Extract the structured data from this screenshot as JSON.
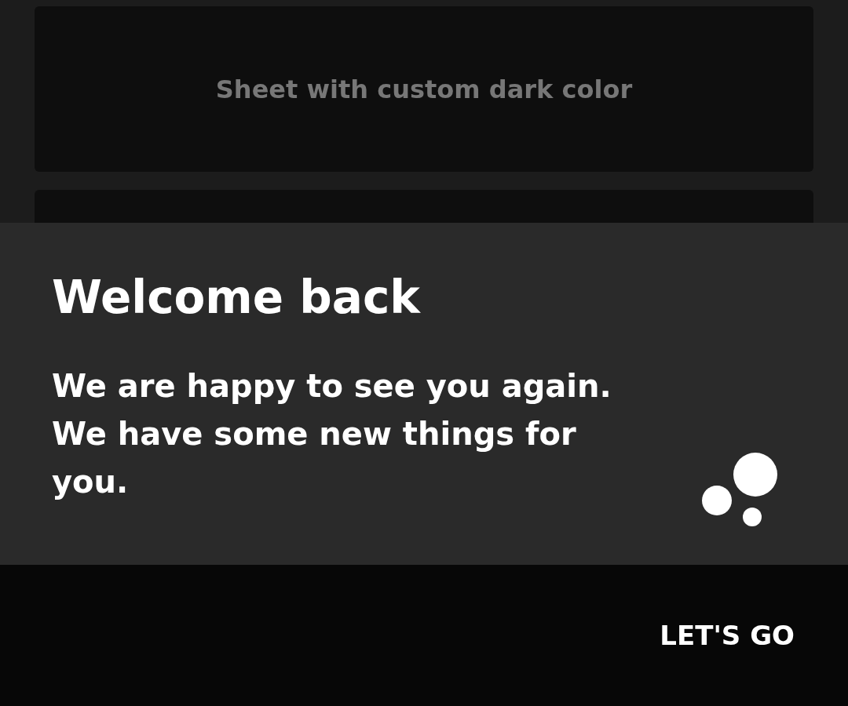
{
  "background_cards": [
    {
      "kind": "labeled",
      "label": "Sheet with custom dark color"
    },
    {
      "kind": "blank"
    }
  ],
  "sheet": {
    "title": "Welcome back",
    "message": "We are happy to see you again. We have some new things for you."
  },
  "action_bar": {
    "button": "LET'S GO"
  }
}
